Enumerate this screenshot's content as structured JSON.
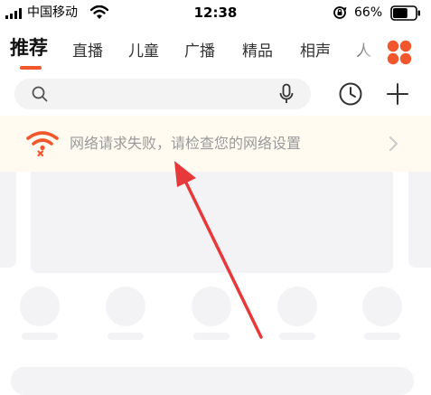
{
  "status_bar": {
    "carrier": "中国移动",
    "time": "12:38",
    "battery_percent": "66%",
    "battery_level": 0.66
  },
  "tabs": [
    {
      "label": "推荐",
      "active": true
    },
    {
      "label": "直播"
    },
    {
      "label": "儿童"
    },
    {
      "label": "广播"
    },
    {
      "label": "精品"
    },
    {
      "label": "相声"
    },
    {
      "label": "人"
    }
  ],
  "search": {
    "placeholder": "",
    "value": ""
  },
  "error_banner": {
    "message": "网络请求失败，请检查您的网络设置"
  },
  "icons": {
    "apps": "apps-grid-icon",
    "search": "search-icon",
    "mic": "mic-icon",
    "history": "history-icon",
    "add": "add-icon",
    "no_network": "wifi-off-icon",
    "chevron": "chevron-right-icon"
  },
  "colors": {
    "accent": "#f2562d",
    "banner_bg": "#fffbf0",
    "skeleton": "#f3f3f5"
  }
}
